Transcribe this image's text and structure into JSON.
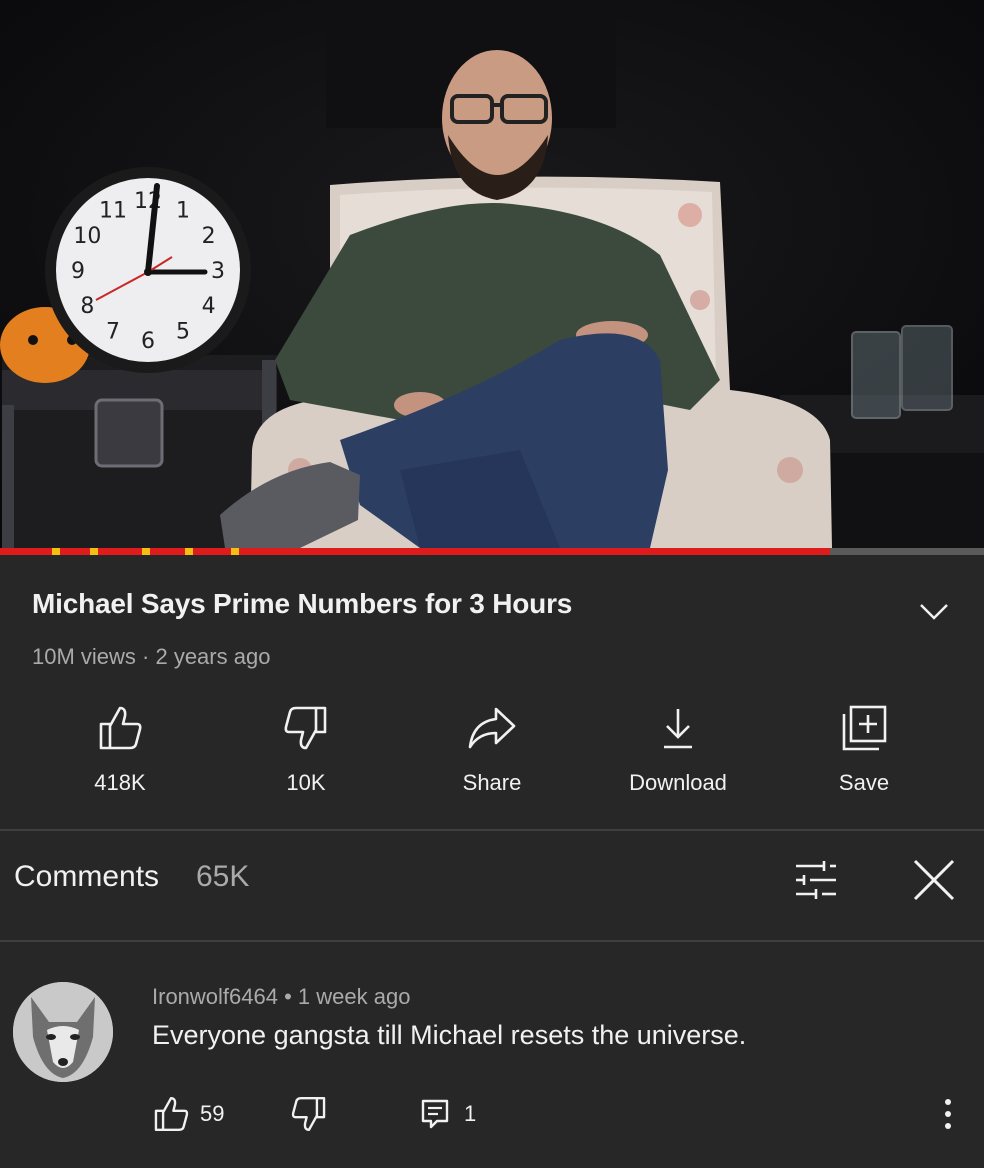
{
  "video": {
    "progress_fraction": 0.843,
    "clock_numbers": [
      "12",
      "1",
      "2",
      "3",
      "4",
      "5",
      "6",
      "7",
      "8",
      "9",
      "10",
      "11"
    ]
  },
  "info": {
    "title": "Michael Says Prime Numbers for 3 Hours",
    "meta": "10M views · 2 years ago",
    "expand_icon": "chevron-down-icon"
  },
  "actions": [
    {
      "icon": "thumbs-up-icon",
      "label": "418K"
    },
    {
      "icon": "thumbs-down-icon",
      "label": "10K"
    },
    {
      "icon": "share-icon",
      "label": "Share"
    },
    {
      "icon": "download-icon",
      "label": "Download"
    },
    {
      "icon": "save-playlist-icon",
      "label": "Save"
    }
  ],
  "comments": {
    "heading": "Comments",
    "count": "65K",
    "sort_icon": "sliders-icon",
    "close_icon": "close-icon",
    "items": [
      {
        "author_line": "Ironwolf6464 • 1 week ago",
        "text": "Everyone gangsta till Michael resets the universe.",
        "likes": "59",
        "replies": "1"
      }
    ]
  },
  "colors": {
    "background": "#272727",
    "text": "#f1f1f1",
    "secondary_text": "#aaaaaa",
    "progress_red": "#e01b1b",
    "chapter_marker": "#f3c012"
  }
}
